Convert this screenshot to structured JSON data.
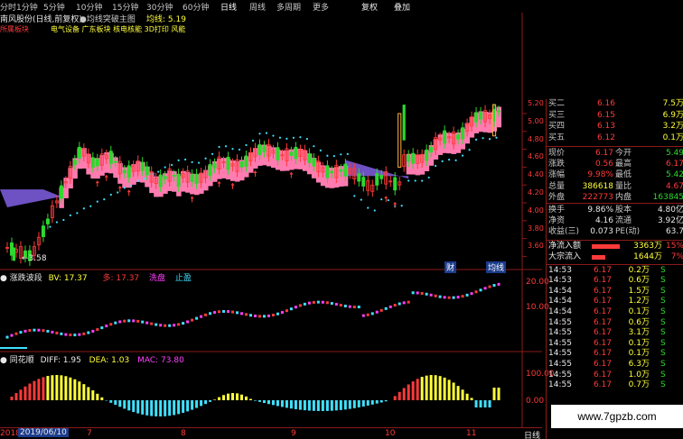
{
  "tabs": [
    "分时",
    "1分钟",
    "5分钟",
    "10分钟",
    "15分钟",
    "30分钟",
    "60分钟",
    "日线",
    "周线",
    "多周期",
    "更多"
  ],
  "active_tab": "日线",
  "right_tabs": [
    "复权",
    "叠加"
  ],
  "title": {
    "stock": "南风股份(日线,前复权)",
    "indicator": "均线突破主图",
    "ma_label": "均线: 5.19"
  },
  "tags": {
    "left": "所属板块",
    "sectors": "电气设备 广东板块 核电核能 3D打印 风能"
  },
  "price_axis": [
    "5.20",
    "5.00",
    "4.80",
    "4.60",
    "4.40",
    "4.20",
    "4.00",
    "3.80",
    "3.60"
  ],
  "low_marker": "3.58",
  "panel_markers": [
    "财",
    "均线"
  ],
  "sub1": {
    "name": "涨跌波段",
    "bv": "BV: 17.37",
    "duo": "多: 17.37",
    "xi": "洗盘",
    "zhi": "止盈",
    "axis": [
      "20.00",
      "10.00"
    ]
  },
  "sub2": {
    "name": "同花顺",
    "diff": "DIFF: 1.95",
    "dea": "DEA: 1.03",
    "mac": "MAC: 73.80",
    "axis": [
      "100.00",
      "0.00"
    ]
  },
  "date_axis": {
    "left": "2018",
    "date": "2019/06/10",
    "ticks": [
      "7",
      "8",
      "9",
      "10",
      "11"
    ],
    "right_label": "日线"
  },
  "orderbook": [
    {
      "label": "买二",
      "price": "6.16",
      "vol": "7.5万"
    },
    {
      "label": "买三",
      "price": "6.15",
      "vol": "6.9万"
    },
    {
      "label": "买四",
      "price": "6.13",
      "vol": "3.2万"
    },
    {
      "label": "买五",
      "price": "6.12",
      "vol": "0.1万"
    }
  ],
  "stats": [
    {
      "l1": "现价",
      "v1": "6.17",
      "c1": "red",
      "l2": "今开",
      "v2": "5.49",
      "c2": "green"
    },
    {
      "l1": "涨跌",
      "v1": "0.56",
      "c1": "red",
      "l2": "最高",
      "v2": "6.17",
      "c2": "red"
    },
    {
      "l1": "涨幅",
      "v1": "9.98%",
      "c1": "red",
      "l2": "最低",
      "v2": "5.42",
      "c2": "green"
    },
    {
      "l1": "总量",
      "v1": "386618",
      "c1": "yellow",
      "l2": "量比",
      "v2": "4.67",
      "c2": "red"
    },
    {
      "l1": "外盘",
      "v1": "222773",
      "c1": "red",
      "l2": "内盘",
      "v2": "163845",
      "c2": "green"
    },
    {
      "l1": "换手",
      "v1": "9.86%",
      "c1": "white",
      "l2": "股本",
      "v2": "4.80亿",
      "c2": "white"
    },
    {
      "l1": "净资",
      "v1": "4.16",
      "c1": "white",
      "l2": "流通",
      "v2": "3.92亿",
      "c2": "white"
    },
    {
      "l1": "收益(三)",
      "v1": "0.073",
      "c1": "white",
      "l2": "PE(动)",
      "v2": "63.7",
      "c2": "white"
    }
  ],
  "flows": [
    {
      "label": "净流入额",
      "value": "3363万",
      "pct": "15%",
      "fill": 0.82
    },
    {
      "label": "大宗流入",
      "value": "1644万",
      "pct": "7%",
      "fill": 0.4
    }
  ],
  "ticks": [
    {
      "t": "14:53",
      "p": "6.17",
      "v": "0.2万",
      "s": "S"
    },
    {
      "t": "14:53",
      "p": "6.17",
      "v": "0.6万",
      "s": "S"
    },
    {
      "t": "14:54",
      "p": "6.17",
      "v": "1.5万",
      "s": "S"
    },
    {
      "t": "14:54",
      "p": "6.17",
      "v": "1.2万",
      "s": "S"
    },
    {
      "t": "14:54",
      "p": "6.17",
      "v": "0.1万",
      "s": "S"
    },
    {
      "t": "14:55",
      "p": "6.17",
      "v": "0.6万",
      "s": "S"
    },
    {
      "t": "14:55",
      "p": "6.17",
      "v": "3.1万",
      "s": "S"
    },
    {
      "t": "14:55",
      "p": "6.17",
      "v": "0.1万",
      "s": "S"
    },
    {
      "t": "14:55",
      "p": "6.17",
      "v": "0.1万",
      "s": "S"
    },
    {
      "t": "14:55",
      "p": "6.17",
      "v": "6.3万",
      "s": "S"
    },
    {
      "t": "14:55",
      "p": "6.17",
      "v": "1.0万",
      "s": "S"
    },
    {
      "t": "14:55",
      "p": "6.17",
      "v": "0.7万",
      "s": "S"
    }
  ],
  "watermark": "www.7gpzb.com",
  "colors": {
    "up": "#ff3a3a",
    "down": "#2ed82e",
    "band": "#ff7bb0",
    "purple": "#7a5ad8",
    "dots": "#40e0ff",
    "grid": "#8b1a1a"
  }
}
